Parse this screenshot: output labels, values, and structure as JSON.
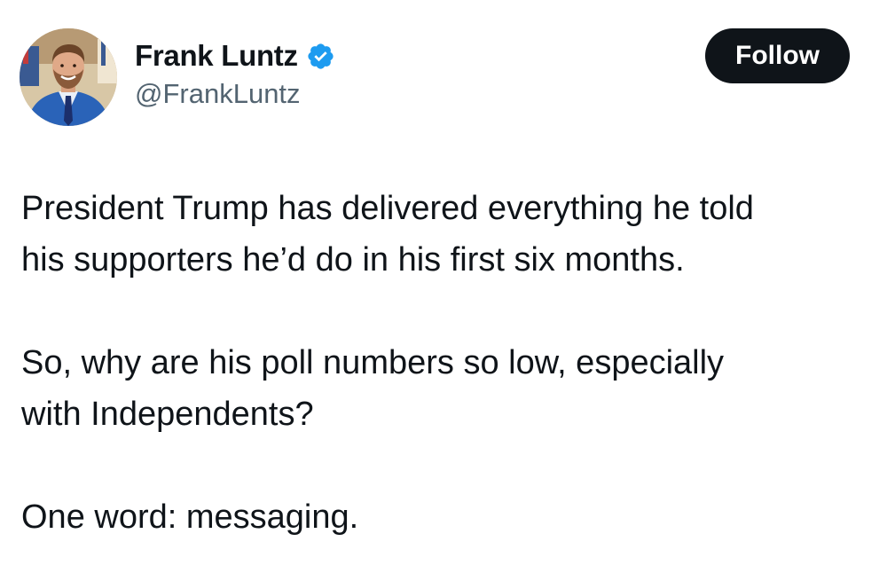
{
  "author": {
    "display_name": "Frank Luntz",
    "handle": "@FrankLuntz",
    "verified": true,
    "verified_icon": "verified-badge-icon",
    "verified_color": "#1d9bf0"
  },
  "follow_button": {
    "label": "Follow",
    "background": "#0f1419",
    "text_color": "#ffffff"
  },
  "tweet": {
    "paragraphs": [
      "President Trump has delivered everything he told\nhis supporters he’d do in his first six months.",
      "So, why are his poll numbers so low, especially\nwith Independents?",
      "One word: messaging."
    ]
  }
}
